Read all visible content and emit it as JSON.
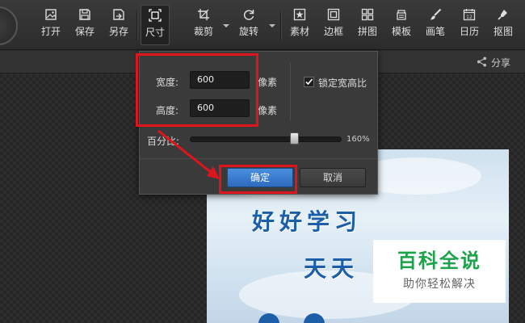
{
  "toolbar": {
    "items": [
      {
        "label": "打开",
        "icon": "open-image-icon"
      },
      {
        "label": "保存",
        "icon": "save-icon"
      },
      {
        "label": "另存",
        "icon": "save-as-icon"
      },
      {
        "label": "尺寸",
        "icon": "resize-icon",
        "active": true
      },
      {
        "label": "裁剪",
        "icon": "crop-icon"
      },
      {
        "label": "旋转",
        "icon": "rotate-icon"
      },
      {
        "label": "素材",
        "icon": "star-icon"
      },
      {
        "label": "边框",
        "icon": "frame-icon"
      },
      {
        "label": "拼图",
        "icon": "grid-icon"
      },
      {
        "label": "模板",
        "icon": "template-icon"
      },
      {
        "label": "画笔",
        "icon": "brush-icon"
      },
      {
        "label": "日历",
        "icon": "calendar-icon"
      },
      {
        "label": "抠图",
        "icon": "cutout-icon"
      }
    ],
    "calendar_day": "12"
  },
  "subbar": {
    "share_label": "分享"
  },
  "dialog": {
    "width_label": "宽度:",
    "width_value": "600",
    "height_label": "高度:",
    "height_value": "600",
    "unit": "像素",
    "lock_label": "锁定宽高比",
    "lock_checked": true,
    "percent_label": "百分比:",
    "percent_value": "160%",
    "percent_level": 0.7,
    "confirm_label": "确定",
    "cancel_label": "取消"
  },
  "photo": {
    "line1": "好好学习",
    "line2": "天天"
  },
  "watermark": {
    "title": "百科全说",
    "subtitle": "助你轻松解决"
  },
  "colors": {
    "highlight": "#e0141c",
    "primary_button": "#2d6bbf",
    "watermark_green": "#1ba24a"
  }
}
